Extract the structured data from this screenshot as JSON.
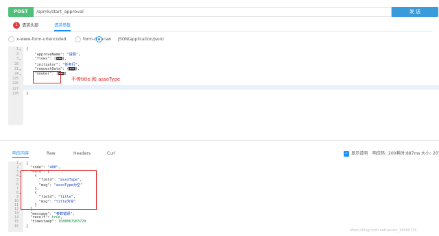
{
  "request": {
    "method": "POST",
    "url": "/spmk/start_approval",
    "send_label": "发 送"
  },
  "request_tabs": {
    "badge_count": "1",
    "headers_label": "请求头部",
    "params_label": "请求参数"
  },
  "body_types": {
    "urlencoded": "x-www-form-urlencoded",
    "formdata": "form-data",
    "raw": "raw",
    "json_select": "JSON(application/json)"
  },
  "request_body": {
    "line_numbers": [
      "1",
      "2",
      "3",
      "20",
      "21",
      "24",
      "225",
      "226",
      "227",
      "228"
    ],
    "lines": [
      "{",
      "    \"approveName\": \"请假\",",
      "    \"flows\": [▪▪▪],",
      "    \"initiator\": \"任务行\",",
      "    \"requestData\": {▪▪▪},",
      "    \"nouber\": [▪▪▪]",
      "",
      "",
      "",
      "}"
    ]
  },
  "annotation": "不传title 和 assoType",
  "response_tabs": {
    "body_label": "响应内容",
    "raw_label": "Raw",
    "headers_label": "Headers",
    "cookie_label": "Curl",
    "show_desc_label": "显示说明",
    "status_label": "响应码:",
    "status_value": "200",
    "time_label": "耗时:",
    "time_value": "887ms",
    "size_label": "大小:",
    "size_value": "207"
  },
  "response_body": {
    "line_numbers": [
      "1",
      "2",
      "3",
      "4",
      "5",
      "6",
      "7",
      "8",
      "9",
      "10",
      "11",
      "12",
      "13",
      "14",
      "15",
      "16"
    ],
    "lines": [
      "{",
      "  \"code\": \"400\",",
      "  \"data\": [",
      "    {",
      "      \"field\": \"assoType\",",
      "      \"msg\": \"assoType为空\"",
      "    },",
      "    {",
      "      \"field\": \"title\",",
      "      \"msg\": \"title为空\"",
      "    }",
      "  ],",
      "  \"message\": \"参数错误\",",
      "  \"result\": true,",
      "  \"timestamp\": 1588067983720",
      "}"
    ]
  },
  "watermark": "https://blog.csdn.net/weixin_38089716",
  "colors": {
    "method_bg": "#4ec07a",
    "send_bg": "#3a9bdb",
    "accent": "#1890ff",
    "annotation": "#e02020"
  }
}
